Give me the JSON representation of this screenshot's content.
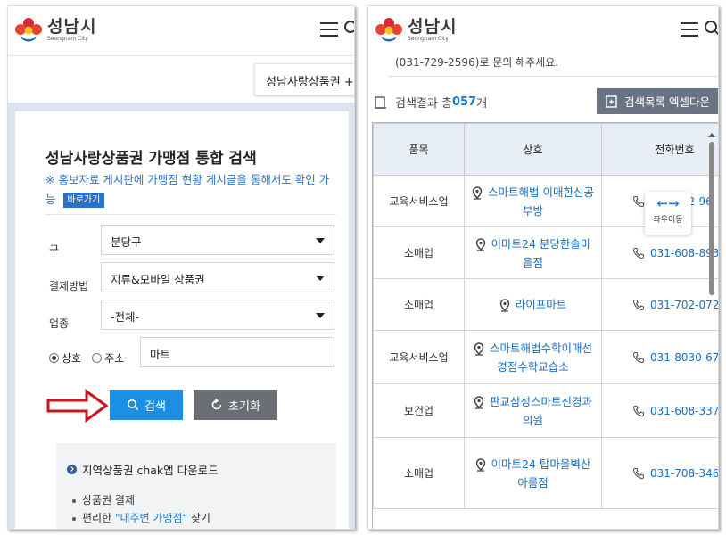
{
  "left": {
    "logo": {
      "name": "성남시",
      "english": "Seongnam City"
    },
    "tab_label": "성남사랑상품권 +",
    "title": "성남사랑상품권 가맹점 통합 검색",
    "note": "※ 홍보자료 게시판에 가맹점 현황 게시글을 통해서도 확인 가능",
    "goto_label": "바로가기",
    "fields": {
      "gu": {
        "label": "구",
        "value": "분당구"
      },
      "payment": {
        "label": "결제방법",
        "value": "지류&모바일 상품권"
      },
      "category": {
        "label": "업종",
        "value": "-전체-"
      }
    },
    "radio": {
      "option1": "상호",
      "option2": "주소",
      "selected": "상호"
    },
    "keyword": "마트",
    "search_label": "검색",
    "reset_label": "초기화",
    "app": {
      "title": "지역상품권 chak앱 다운로드",
      "item1": "상품권 결제",
      "item2_prefix": "편리한 ",
      "item2_highlight": "\"내주변 가맹점\"",
      "item2_suffix": " 찾기"
    }
  },
  "right": {
    "logo": {
      "name": "성남시",
      "english": "Seongnam City"
    },
    "contact": "(031-729-2596)로 문의 해주세요.",
    "result_prefix": "검색결과 총 ",
    "result_count": "057",
    "result_suffix": "개",
    "excel_label": "검색목록 엑셀다운",
    "table": {
      "headers": [
        "품목",
        "상호",
        "전화번호"
      ],
      "rows": [
        {
          "category": "교육서비스업",
          "name": "스마트해법 이매한신공부방",
          "phone": "031-702-96"
        },
        {
          "category": "소매업",
          "name": "이마트24 분당한솔마을점",
          "phone": "031-608-893"
        },
        {
          "category": "소매업",
          "name": "라이프마트",
          "phone": "031-702-072"
        },
        {
          "category": "교육서비스업",
          "name": "스마트해법수학이매선경점수학교습소",
          "phone": "031-8030-67"
        },
        {
          "category": "보건업",
          "name": "판교삼성스마트신경과의원",
          "phone": "031-608-337"
        },
        {
          "category": "소매업",
          "name": "이마트24 탑마을벽산아름점",
          "phone": "031-708-346"
        }
      ]
    },
    "swipe_hint": "좌우이동"
  },
  "colors": {
    "accent": "#1a8fe3",
    "link": "#1a6fbf",
    "reset": "#6b6e72",
    "excel": "#6a7384",
    "arrow": "#c8141e"
  }
}
